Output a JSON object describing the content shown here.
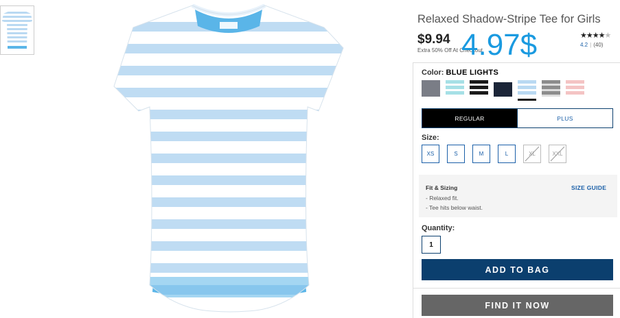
{
  "product": {
    "title": "Relaxed Shadow-Stripe Tee for Girls",
    "price": "$9.94",
    "promo": "Extra 50% Off At Checkout",
    "overlay_price": "4.97$",
    "rating": {
      "stars": 4,
      "max_stars": 5,
      "score": "4.2",
      "count": "(40)"
    }
  },
  "color": {
    "label": "Color:",
    "selected_name": "BLUE LIGHTS",
    "swatches": [
      {
        "name": "gray-heather",
        "colors": [
          "#7a7d86",
          "#9a9ca4"
        ]
      },
      {
        "name": "aqua-stripe",
        "colors": [
          "#a6e0e6",
          "#ffffff"
        ]
      },
      {
        "name": "black-white-stripe",
        "colors": [
          "#1a1a1a",
          "#ffffff"
        ]
      },
      {
        "name": "navy",
        "colors": [
          "#1b2538",
          "#ffffff"
        ]
      },
      {
        "name": "blue-lights",
        "colors": [
          "#b9d9f2",
          "#ffffff"
        ],
        "selected": true
      },
      {
        "name": "gray-stripe",
        "colors": [
          "#8c8c8c",
          "#dcdcdc"
        ]
      },
      {
        "name": "pink-stripe",
        "colors": [
          "#f4c4c4",
          "#ffffff"
        ]
      }
    ]
  },
  "fit_tabs": {
    "regular": "REGULAR",
    "plus": "PLUS"
  },
  "size": {
    "label": "Size:",
    "options": [
      {
        "label": "XS",
        "available": true
      },
      {
        "label": "S",
        "available": true
      },
      {
        "label": "M",
        "available": true
      },
      {
        "label": "L",
        "available": true
      },
      {
        "label": "XL",
        "available": false
      },
      {
        "label": "XXL",
        "available": false
      }
    ]
  },
  "fit": {
    "title": "Fit & Sizing",
    "guide_label": "SIZE GUIDE",
    "notes": [
      "- Relaxed fit.",
      "- Tee hits below waist."
    ]
  },
  "quantity": {
    "label": "Quantity:",
    "value": "1"
  },
  "actions": {
    "add_to_bag": "ADD TO BAG",
    "find_it_now": "FIND IT NOW"
  },
  "colors": {
    "primary_blue": "#0b3f6e",
    "link_blue": "#1a5fa8",
    "overlay_blue": "#1a9ae0",
    "find_gray": "#666666"
  }
}
